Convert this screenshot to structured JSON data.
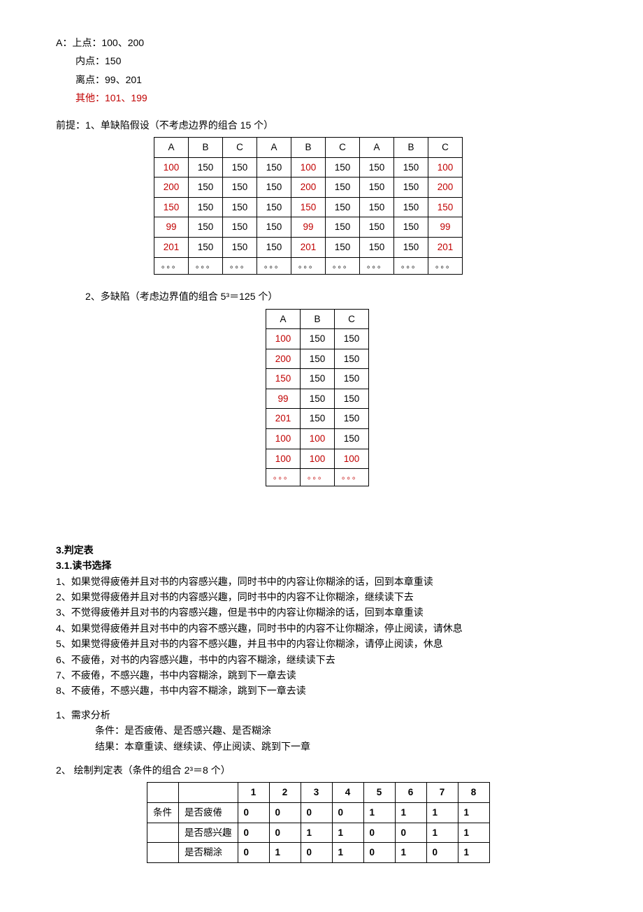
{
  "points": {
    "label_a": "A：上点：100、200",
    "inner": "内点：150",
    "outer": "离点：99、201",
    "other": "其他：101、199"
  },
  "premise": {
    "line": "前提：1、单缺陷假设（不考虑边界的组合   15 个）"
  },
  "table1": {
    "headers": [
      "A",
      "B",
      "C",
      "A",
      "B",
      "C",
      "A",
      "B",
      "C"
    ],
    "rows": [
      [
        "100",
        "150",
        "150",
        "150",
        "100",
        "150",
        "150",
        "150",
        "100"
      ],
      [
        "200",
        "150",
        "150",
        "150",
        "200",
        "150",
        "150",
        "150",
        "200"
      ],
      [
        "150",
        "150",
        "150",
        "150",
        "150",
        "150",
        "150",
        "150",
        "150"
      ],
      [
        "99",
        "150",
        "150",
        "150",
        "99",
        "150",
        "150",
        "150",
        "99"
      ],
      [
        "201",
        "150",
        "150",
        "150",
        "201",
        "150",
        "150",
        "150",
        "201"
      ],
      [
        "。。。",
        "。。。",
        "。。。",
        "。。。",
        "。。。",
        "。。。",
        "。。。",
        "。。。",
        "。。。"
      ]
    ],
    "red_cols_by_group": [
      0,
      4,
      8
    ]
  },
  "multi_defect": {
    "line": "2、多缺陷（考虑边界值的组合   5³＝125 个）"
  },
  "table2": {
    "headers": [
      "A",
      "B",
      "C"
    ],
    "rows": [
      {
        "cells": [
          "100",
          "150",
          "150"
        ],
        "red": [
          0
        ]
      },
      {
        "cells": [
          "200",
          "150",
          "150"
        ],
        "red": [
          0
        ]
      },
      {
        "cells": [
          "150",
          "150",
          "150"
        ],
        "red": [
          0
        ]
      },
      {
        "cells": [
          "99",
          "150",
          "150"
        ],
        "red": [
          0
        ]
      },
      {
        "cells": [
          "201",
          "150",
          "150"
        ],
        "red": [
          0
        ]
      },
      {
        "cells": [
          "100",
          "100",
          "150"
        ],
        "red": [
          0,
          1
        ]
      },
      {
        "cells": [
          "100",
          "100",
          "100"
        ],
        "red": [
          0,
          1,
          2
        ]
      },
      {
        "cells": [
          "。。。",
          "。。。",
          "。。。"
        ],
        "red": [
          0,
          1,
          2
        ],
        "ellip": true
      }
    ]
  },
  "section3": {
    "h1": "3.判定表",
    "h2": "3.1.读书选择",
    "rules": [
      "1、如果觉得疲倦并且对书的内容感兴趣，同时书中的内容让你糊涂的话，回到本章重读",
      "2、如果觉得疲倦并且对书的内容感兴趣，同时书中的内容不让你糊涂，继续读下去",
      "3、不觉得疲倦并且对书的内容感兴趣，但是书中的内容让你糊涂的话，回到本章重读",
      "4、如果觉得疲倦并且对书中的内容不感兴趣，同时书中的内容不让你糊涂，停止阅读，请休息",
      "5、如果觉得疲倦并且对书的内容不感兴趣，并且书中的内容让你糊涂，请停止阅读，休息",
      "6、不疲倦，对书的内容感兴趣，书中的内容不糊涂，继续读下去",
      "7、不疲倦，不感兴趣，书中内容糊涂，跳到下一章去读",
      "8、不疲倦，不感兴趣，书中内容不糊涂，跳到下一章去读"
    ],
    "req": {
      "title": "1、需求分析",
      "cond": "条件：是否疲倦、是否感兴趣、是否糊涂",
      "result": "结果：本章重读、继续读、停止阅读、跳到下一章"
    },
    "draw": "2、 绘制判定表（条件的组合  2³＝8 个）"
  },
  "table3": {
    "headers": [
      "",
      "",
      "1",
      "2",
      "3",
      "4",
      "5",
      "6",
      "7",
      "8"
    ],
    "rows": [
      [
        "条件",
        "是否疲倦",
        "0",
        "0",
        "0",
        "0",
        "1",
        "1",
        "1",
        "1"
      ],
      [
        "",
        "是否感兴趣",
        "0",
        "0",
        "1",
        "1",
        "0",
        "0",
        "1",
        "1"
      ],
      [
        "",
        "是否糊涂",
        "0",
        "1",
        "0",
        "1",
        "0",
        "1",
        "0",
        "1"
      ]
    ]
  }
}
